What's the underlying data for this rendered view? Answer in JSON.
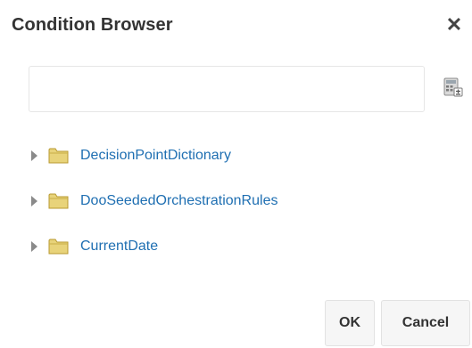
{
  "dialog": {
    "title": "Condition Browser",
    "close_glyph": "✕",
    "close_icon": "close-icon"
  },
  "expression": {
    "value": "",
    "placeholder": ""
  },
  "calculator_icon": "calculator-icon",
  "tree": {
    "items": [
      {
        "label": "DecisionPointDictionary",
        "icon": "folder-icon",
        "expanded": false
      },
      {
        "label": "DooSeededOrchestrationRules",
        "icon": "folder-icon",
        "expanded": false
      },
      {
        "label": "CurrentDate",
        "icon": "folder-icon",
        "expanded": false
      }
    ]
  },
  "buttons": {
    "ok_label": "OK",
    "cancel_label": "Cancel"
  },
  "colors": {
    "link": "#1f6fb2",
    "folder": "#e8d37a",
    "title": "#333333"
  }
}
